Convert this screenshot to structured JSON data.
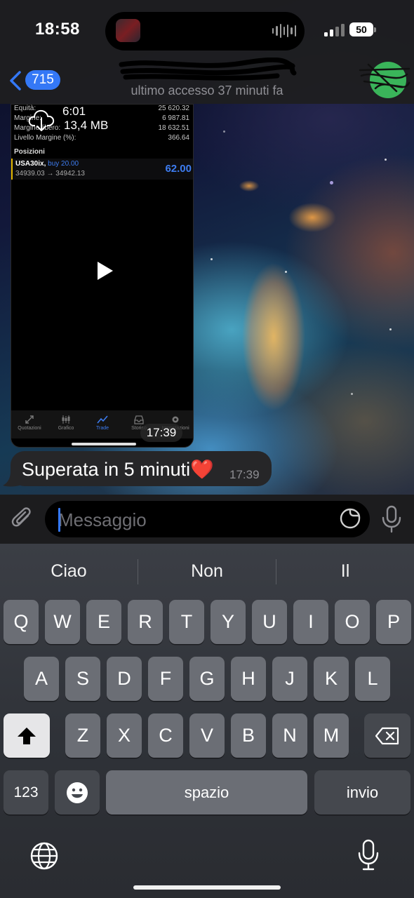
{
  "status_bar": {
    "time": "18:58",
    "battery": "50"
  },
  "header": {
    "back_count": "715",
    "contact_name": "",
    "last_seen": "ultimo accesso 37 minuti fa"
  },
  "video_message": {
    "download_duration": "6:01",
    "download_size": "13,4 MB",
    "time": "17:39",
    "screen": {
      "rows": [
        {
          "label": "Equità:",
          "value": "25 620.32"
        },
        {
          "label": "Margine:",
          "value": "6 987.81"
        },
        {
          "label": "Margine libero:",
          "value": "18 632.51"
        },
        {
          "label": "Livello Margine (%):",
          "value": "366.64"
        }
      ],
      "section_title": "Posizioni",
      "position": {
        "symbol": "USA30ix,",
        "side": "buy 20.00",
        "price_from": "34939.03",
        "arrow": "→",
        "price_to": "34942.13",
        "profit": "62.00"
      },
      "tabs": [
        "Quotazioni",
        "Grafico",
        "Trade",
        "Storico",
        "Impostazioni"
      ]
    }
  },
  "text_message": {
    "text": "Superata in 5 minuti❤️",
    "time": "17:39"
  },
  "composer": {
    "placeholder": "Messaggio"
  },
  "keyboard": {
    "suggestions": [
      "Ciao",
      "Non",
      "Il"
    ],
    "row1": [
      "Q",
      "W",
      "E",
      "R",
      "T",
      "Y",
      "U",
      "I",
      "O",
      "P"
    ],
    "row2": [
      "A",
      "S",
      "D",
      "F",
      "G",
      "H",
      "J",
      "K",
      "L"
    ],
    "row3": [
      "Z",
      "X",
      "C",
      "V",
      "B",
      "N",
      "M"
    ],
    "numbers_key": "123",
    "space_key": "spazio",
    "return_key": "invio"
  },
  "colors": {
    "accent": "#3478f6",
    "mt_profit": "#3d7cf0",
    "avatar": "#3ab45a",
    "bubble": "#262628"
  },
  "icons": [
    "chevron-left-icon",
    "download-cloud-icon",
    "play-icon",
    "attach-icon",
    "sticker-icon",
    "microphone-icon",
    "shift-icon",
    "backspace-icon",
    "emoji-icon",
    "globe-icon",
    "dictation-icon"
  ]
}
